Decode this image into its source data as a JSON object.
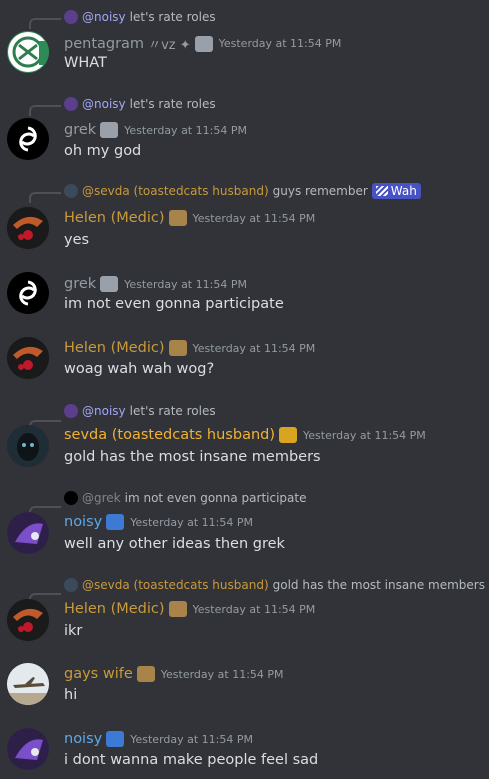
{
  "messages": [
    {
      "reply": {
        "mention": "@noisy",
        "text": "let's rate roles"
      },
      "author": "pentagram",
      "author_suffix": "〃vz ✦",
      "timestamp": "Yesterday at 11:54 PM",
      "text": "WHAT",
      "name_color": "#949ba4"
    },
    {
      "reply": {
        "mention": "@noisy",
        "text": "let's rate roles"
      },
      "author": "grek",
      "timestamp": "Yesterday at 11:54 PM",
      "text": "oh my god",
      "name_color": "#949ba4"
    },
    {
      "reply": {
        "mention": "@sevda (toastedcats husband)",
        "text": "guys remember",
        "tag": "Wah"
      },
      "author": "Helen (Medic)",
      "timestamp": "Yesterday at 11:54 PM",
      "text": "yes",
      "name_color": "#c99a3a"
    },
    {
      "author": "grek",
      "timestamp": "Yesterday at 11:54 PM",
      "text": "im not even gonna participate",
      "name_color": "#949ba4"
    },
    {
      "author": "Helen (Medic)",
      "timestamp": "Yesterday at 11:54 PM",
      "text": "woag wah wah wog?",
      "name_color": "#c99a3a"
    },
    {
      "reply": {
        "mention": "@noisy",
        "text": "let's rate roles"
      },
      "author": "sevda (toastedcats husband)",
      "timestamp": "Yesterday at 11:54 PM",
      "text": "gold has the most insane members",
      "name_color": "#f0b232"
    },
    {
      "reply": {
        "mention": "@grek",
        "text": "im not even gonna participate"
      },
      "author": "noisy",
      "timestamp": "Yesterday at 11:54 PM",
      "text": "well any other ideas then grek",
      "name_color": "#5fa8e8"
    },
    {
      "reply": {
        "mention": "@sevda (toastedcats husband)",
        "text": "gold has the most insane members"
      },
      "author": "Helen (Medic)",
      "timestamp": "Yesterday at 11:54 PM",
      "text": "ikr",
      "name_color": "#c99a3a"
    },
    {
      "author": "gays wife",
      "timestamp": "Yesterday at 11:54 PM",
      "text": "hi",
      "name_color": "#c99a3a"
    },
    {
      "author": "noisy",
      "timestamp": "Yesterday at 11:54 PM",
      "text": "i dont wanna make people feel sad",
      "name_color": "#5fa8e8"
    }
  ]
}
